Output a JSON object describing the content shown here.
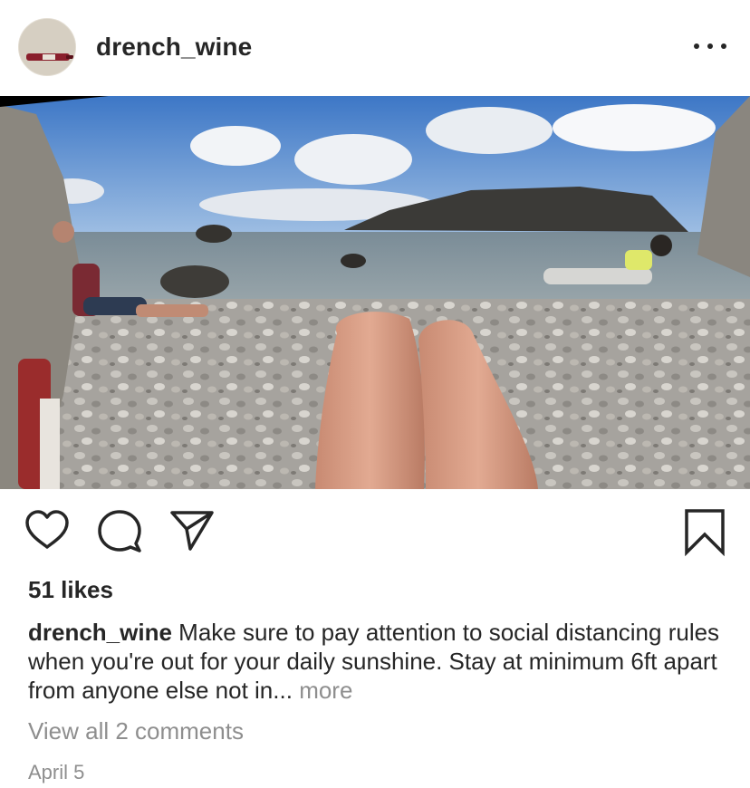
{
  "post": {
    "username": "drench_wine",
    "menu_icon": "more-horizontal-icon",
    "photo_alt": "",
    "likes": "51 likes",
    "caption_user": "drench_wine",
    "caption_text": "Make sure to pay attention to social distancing rules when you're out for your daily sunshine. Stay at minimum 6ft apart from anyone else not in...",
    "caption_more": "more",
    "view_comments": "View all 2 comments",
    "date": "April 5"
  },
  "actions": {
    "like_icon": "heart-icon",
    "comment_icon": "comment-icon",
    "share_icon": "send-icon",
    "save_icon": "bookmark-icon"
  },
  "colors": {
    "text": "#262626",
    "secondary_text": "#8e8e8e",
    "background": "#ffffff"
  }
}
